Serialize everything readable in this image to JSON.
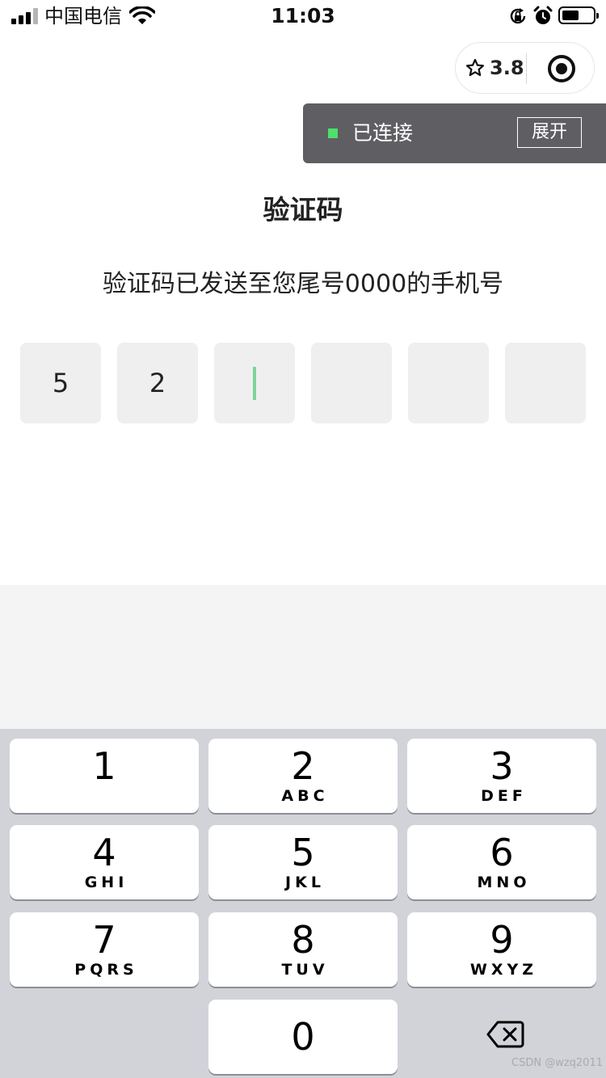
{
  "status_bar": {
    "carrier": "中国电信",
    "time": "11:03"
  },
  "capsule": {
    "rating": "3.8"
  },
  "toast": {
    "status": "已连接",
    "expand_label": "展开",
    "status_color": "#4ee06a"
  },
  "page": {
    "title": "验证码",
    "subtitle": "验证码已发送至您尾号0000的手机号"
  },
  "code_input": {
    "digits": [
      "5",
      "2",
      "",
      "",
      "",
      ""
    ],
    "caret_color": "#7fd49a"
  },
  "keypad": {
    "keys": [
      {
        "num": "1",
        "letters": ""
      },
      {
        "num": "2",
        "letters": "ABC"
      },
      {
        "num": "3",
        "letters": "DEF"
      },
      {
        "num": "4",
        "letters": "GHI"
      },
      {
        "num": "5",
        "letters": "JKL"
      },
      {
        "num": "6",
        "letters": "MNO"
      },
      {
        "num": "7",
        "letters": "PQRS"
      },
      {
        "num": "8",
        "letters": "TUV"
      },
      {
        "num": "9",
        "letters": "WXYZ"
      },
      {
        "num": "0",
        "letters": ""
      }
    ]
  },
  "watermark": "CSDN @wzq2011"
}
